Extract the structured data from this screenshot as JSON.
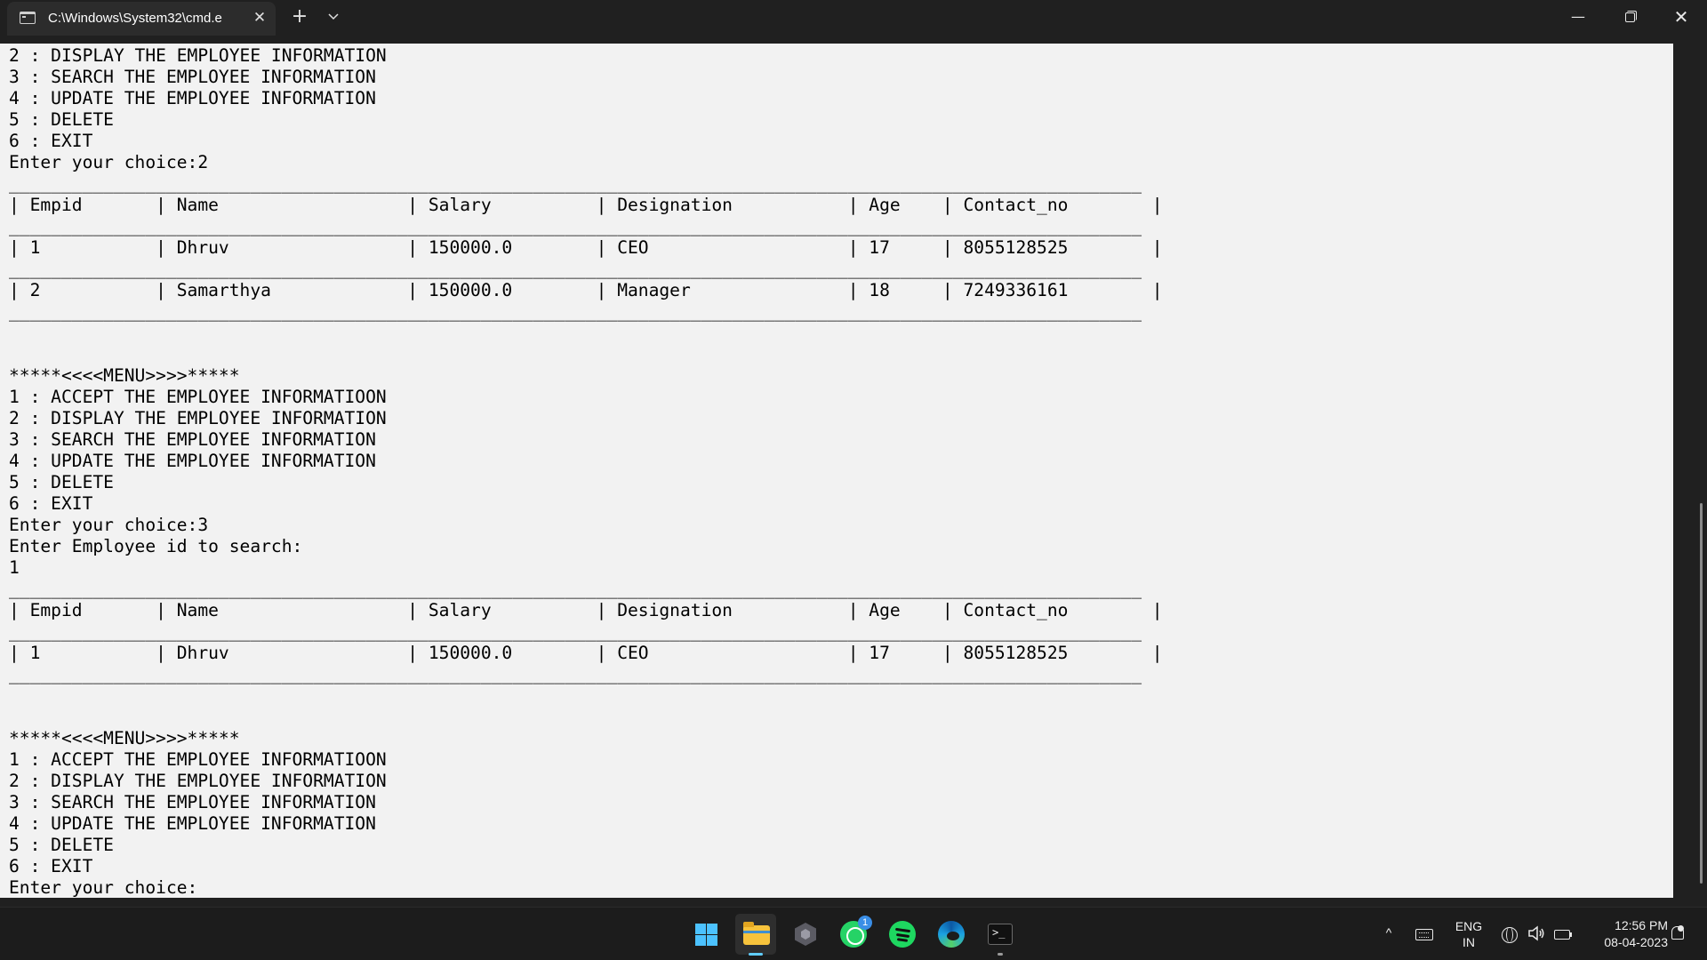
{
  "window": {
    "tab_title": "C:\\Windows\\System32\\cmd.e",
    "close_tab_glyph": "✕",
    "new_tab_glyph": "+",
    "dropdown_glyph": "⌄",
    "minimize_glyph": "—",
    "close_glyph": "✕"
  },
  "console": {
    "lines": [
      "2 : DISPLAY THE EMPLOYEE INFORMATION",
      "3 : SEARCH THE EMPLOYEE INFORMATION",
      "4 : UPDATE THE EMPLOYEE INFORMATION",
      "5 : DELETE",
      "6 : EXIT",
      "Enter your choice:2",
      "____________________________________________________________________________________________________________",
      "| Empid       | Name                  | Salary          | Designation           | Age    | Contact_no        |",
      "____________________________________________________________________________________________________________",
      "| 1           | Dhruv                 | 150000.0        | CEO                   | 17     | 8055128525        |",
      "____________________________________________________________________________________________________________",
      "| 2           | Samarthya             | 150000.0        | Manager               | 18     | 7249336161        |",
      "____________________________________________________________________________________________________________",
      "",
      "",
      "*****<<<<MENU>>>>*****",
      "1 : ACCEPT THE EMPLOYEE INFORMATIOON",
      "2 : DISPLAY THE EMPLOYEE INFORMATION",
      "3 : SEARCH THE EMPLOYEE INFORMATION",
      "4 : UPDATE THE EMPLOYEE INFORMATION",
      "5 : DELETE",
      "6 : EXIT",
      "Enter your choice:3",
      "Enter Employee id to search:",
      "1",
      "____________________________________________________________________________________________________________",
      "| Empid       | Name                  | Salary          | Designation           | Age    | Contact_no        |",
      "____________________________________________________________________________________________________________",
      "| 1           | Dhruv                 | 150000.0        | CEO                   | 17     | 8055128525        |",
      "____________________________________________________________________________________________________________",
      "",
      "",
      "*****<<<<MENU>>>>*****",
      "1 : ACCEPT THE EMPLOYEE INFORMATIOON",
      "2 : DISPLAY THE EMPLOYEE INFORMATION",
      "3 : SEARCH THE EMPLOYEE INFORMATION",
      "4 : UPDATE THE EMPLOYEE INFORMATION",
      "5 : DELETE",
      "6 : EXIT",
      "Enter your choice:"
    ]
  },
  "taskbar": {
    "apps": [
      "start-icon",
      "file-explorer-icon",
      "app-hex-icon",
      "whatsapp-icon",
      "spotify-icon",
      "edge-icon",
      "terminal-icon"
    ],
    "whatsapp_badge": "1",
    "tray_chevron": "^",
    "lang_line1": "ENG",
    "lang_line2": "IN",
    "speaker_glyph": "🔊",
    "time": "12:56 PM",
    "date": "08-04-2023"
  },
  "colors": {
    "console_bg": "#f2f2f2",
    "chrome_bg": "#202020",
    "taskbar_bg": "#1c1c1c",
    "accent": "#60cdff"
  }
}
